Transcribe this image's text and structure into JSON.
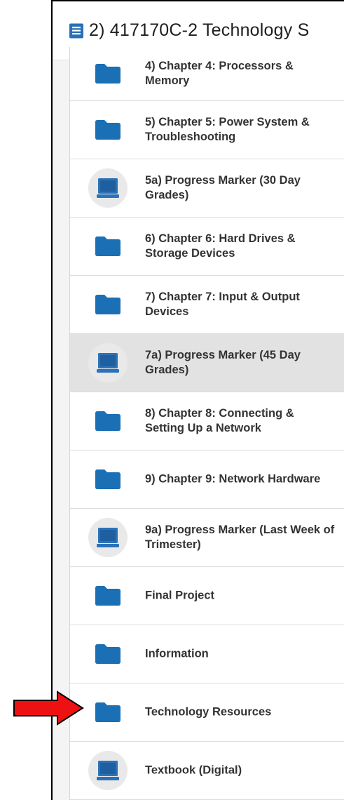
{
  "header": {
    "title": "2) 417170C-2 Technology S",
    "icon": "notebook-icon",
    "icon_color": "#2a6fb5"
  },
  "colors": {
    "folder": "#1a6fb5",
    "computer": "#2b72b8",
    "arrow_fill": "#ee1111",
    "arrow_stroke": "#000000",
    "selected_bg": "#e2e2e2"
  },
  "items": [
    {
      "label": "4) Chapter 4: Processors & Memory",
      "icon": "folder-icon"
    },
    {
      "label": "5) Chapter 5: Power System & Troubleshooting",
      "icon": "folder-icon"
    },
    {
      "label": "5a) Progress Marker (30 Day Grades)",
      "icon": "computer-icon"
    },
    {
      "label": "6) Chapter 6: Hard Drives & Storage Devices",
      "icon": "folder-icon"
    },
    {
      "label": "7) Chapter 7: Input & Output Devices",
      "icon": "folder-icon"
    },
    {
      "label": "7a) Progress Marker (45 Day Grades)",
      "icon": "computer-icon",
      "selected": true
    },
    {
      "label": "8) Chapter 8: Connecting & Setting Up a Network",
      "icon": "folder-icon"
    },
    {
      "label": "9) Chapter 9: Network Hardware",
      "icon": "folder-icon"
    },
    {
      "label": "9a) Progress Marker (Last Week of Trimester)",
      "icon": "computer-icon"
    },
    {
      "label": "Final Project",
      "icon": "folder-icon"
    },
    {
      "label": "Information",
      "icon": "folder-icon"
    },
    {
      "label": "Technology Resources",
      "icon": "folder-icon",
      "annotated": true
    },
    {
      "label": "Textbook (Digital)",
      "icon": "computer-icon"
    }
  ],
  "annotation": {
    "icon": "red-arrow-icon"
  }
}
